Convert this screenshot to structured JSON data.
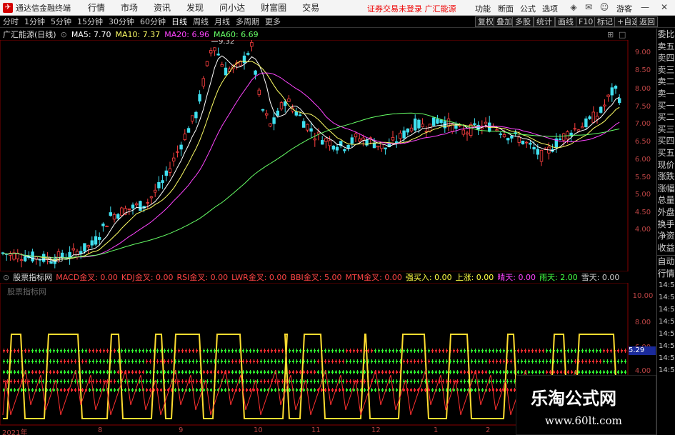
{
  "titlebar": {
    "app_title": "通达信金融终端",
    "menus": [
      "行情",
      "市场",
      "资讯",
      "发现",
      "问小达",
      "财富圈",
      "交易"
    ],
    "notice": "证券交易未登录  广汇能源",
    "right_menus": [
      "功能",
      "断面",
      "公式",
      "选项"
    ]
  },
  "toolbar": {
    "periods": [
      "分时",
      "1分钟",
      "5分钟",
      "15分钟",
      "30分钟",
      "60分钟",
      "日线",
      "周线",
      "月线",
      "多周期",
      "更多"
    ],
    "selected": "日线",
    "tools": [
      "复权",
      "叠加",
      "多股",
      "统计",
      "画线",
      "F10",
      "标记",
      "+自选",
      "返回"
    ]
  },
  "ma": {
    "stock": "广汇能源(日线)",
    "ma5": "MA5: 7.70",
    "ma10": "MA10: 7.37",
    "ma20": "MA20: 6.96",
    "ma60": "MA60: 6.69",
    "ma5_color": "#ffffff",
    "ma10_color": "#ffff66",
    "ma20_color": "#ff44ff",
    "ma60_color": "#66ff66"
  },
  "price_axis": [
    "9.00",
    "8.50",
    "8.00",
    "7.50",
    "7.00",
    "6.50",
    "6.00",
    "5.50",
    "5.00",
    "4.50",
    "4.00"
  ],
  "annotations": {
    "high": "9.32",
    "low": "3.18"
  },
  "indicator": {
    "title": "股票指标网",
    "items": [
      {
        "label": "MACD金叉: 0.00",
        "color": "#ff4444"
      },
      {
        "label": "KDJ金叉: 0.00",
        "color": "#ff4444"
      },
      {
        "label": "RSI金叉: 0.00",
        "color": "#ff4444"
      },
      {
        "label": "LWR金叉: 0.00",
        "color": "#ff4444"
      },
      {
        "label": "BBI金叉: 5.00",
        "color": "#ff4444"
      },
      {
        "label": "MTM金叉: 0.00",
        "color": "#ff4444"
      },
      {
        "label": "强买入: 0.00",
        "color": "#ffff44"
      },
      {
        "label": "上涨: 0.00",
        "color": "#ffff44"
      },
      {
        "label": "晴天: 0.00",
        "color": "#ff44ff"
      },
      {
        "label": "雨天: 2.00",
        "color": "#44ff44"
      },
      {
        "label": "雪天: 0.00",
        "color": "#cccccc"
      }
    ],
    "subtitle": "股票指标网",
    "axis": [
      "10.00",
      "8.00",
      "6.00",
      "4.00"
    ],
    "current": "5.29"
  },
  "right_panel": {
    "top": [
      "委比",
      "卖五",
      "卖四",
      "卖三",
      "卖二",
      "卖一",
      "买一",
      "买二",
      "买三",
      "买四",
      "买五",
      "现价",
      "涨跌",
      "涨幅",
      "总量",
      "外盘",
      "换手",
      "净资",
      "收益"
    ],
    "bottom_title": [
      "自动",
      "行情"
    ],
    "times": [
      "14:5",
      "14:5",
      "14:5",
      "14:5",
      "14:5",
      "14:5",
      "14:5",
      "14:5"
    ]
  },
  "x_axis": [
    "2021年",
    "8",
    "9",
    "10",
    "11",
    "12",
    "1",
    "2"
  ],
  "watermark": {
    "name": "乐淘公式网",
    "url": "www.60lt.com"
  },
  "guest": "游客"
}
